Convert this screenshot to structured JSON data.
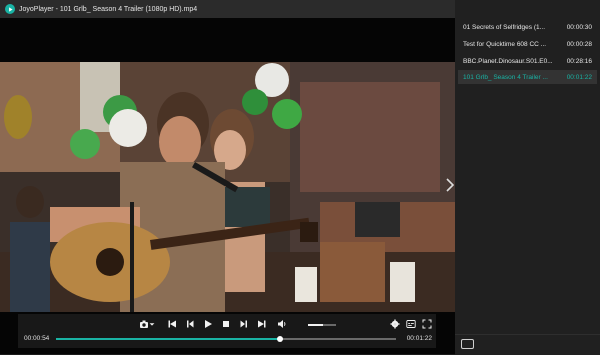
{
  "app": {
    "window_title": "JoyoPlayer - 101 Grlb_ Season 4 Trailer (1080p HD).mp4",
    "accent_color": "#19b3a4"
  },
  "player": {
    "current_time": "00:00:54",
    "total_time": "00:01:22",
    "progress_fraction": 0.659,
    "volume_fraction": 0.55,
    "next_icon": "chevron-right-icon"
  },
  "controls": {
    "icons": [
      "camera-icon",
      "chevron-down-icon",
      "skip-previous-icon",
      "step-back-icon",
      "play-icon",
      "stop-icon",
      "step-forward-icon",
      "skip-next-icon",
      "volume-icon",
      "settings-icon",
      "subtitles-icon",
      "fullscreen-icon"
    ]
  },
  "playlist": {
    "items": [
      {
        "name": "01 Secrets of Selfridges (1...",
        "duration": "00:00:30",
        "active": false
      },
      {
        "name": "Test for Quicktime 608 CC ...",
        "duration": "00:00:28",
        "active": false
      },
      {
        "name": "BBC.Planet.Dinosaur.S01.E0...",
        "duration": "00:28:16",
        "active": false
      },
      {
        "name": "101 Grlb_ Season 4 Trailer ...",
        "duration": "00:01:22",
        "active": true
      }
    ]
  }
}
